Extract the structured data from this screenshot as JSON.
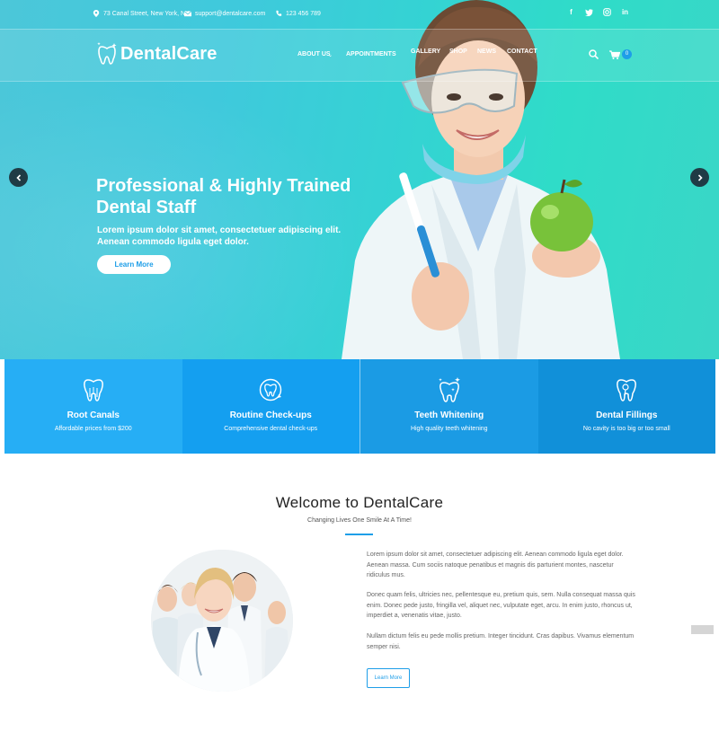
{
  "topbar": {
    "address": "73 Canal Street, New York, NY",
    "email": "support@dentalcare.com",
    "phone": "123 456 789",
    "social": [
      "facebook-icon",
      "twitter-icon",
      "instagram-icon",
      "linkedin-icon"
    ]
  },
  "brand": {
    "name": "DentalCare"
  },
  "nav": {
    "items": [
      {
        "label": "ABOUT US"
      },
      {
        "label": "APPOINTMENTS"
      },
      {
        "label": "GALLERY"
      },
      {
        "label": "SHOP"
      },
      {
        "label": "NEWS"
      },
      {
        "label": "CONTACT"
      }
    ],
    "cart_count": "0"
  },
  "hero": {
    "title_line1": "Professional & Highly Trained",
    "title_line2": "Dental Staff",
    "subtitle_line1": "Lorem ipsum dolor sit amet, consectetuer adipiscing elit.",
    "subtitle_line2": "Aenean commodo ligula eget dolor.",
    "button": "Learn More"
  },
  "services": [
    {
      "title": "Root Canals",
      "desc": "Affordable prices from $200",
      "color": "#26aef5",
      "icon": "tooth-roots-icon"
    },
    {
      "title": "Routine Check-ups",
      "desc": "Comprehensive dental check-ups",
      "color": "#149ff0",
      "icon": "tooth-checkup-icon"
    },
    {
      "title": "Teeth Whitening",
      "desc": "High quality teeth whitening",
      "color": "#1b9be4",
      "icon": "tooth-sparkle-icon"
    },
    {
      "title": "Dental Fillings",
      "desc": "No cavity is too big or too small",
      "color": "#1190d9",
      "icon": "tooth-filling-icon"
    }
  ],
  "welcome": {
    "title": "Welcome to DentalCare",
    "subtitle": "Changing Lives One Smile At A Time!",
    "p1": "Lorem ipsum dolor sit amet, consectetuer adipiscing elit. Aenean commodo ligula eget dolor. Aenean massa. Cum sociis natoque penatibus et magnis dis parturient montes, nascetur ridiculus mus.",
    "p2": "Donec quam felis, ultricies nec, pellentesque eu, pretium quis, sem. Nulla consequat massa quis enim. Donec pede justo, fringilla vel, aliquet nec, vulputate eget, arcu. In enim justo, rhoncus ut, imperdiet a, venenatis vitae, justo.",
    "p3": "Nullam dictum felis eu pede mollis pretium. Integer tincidunt. Cras dapibus. Vivamus elementum semper nisi.",
    "button": "Learn More"
  },
  "colors": {
    "accent": "#1e9ee8",
    "hero_start": "#4cc7d9",
    "hero_end": "#2fdcc8"
  }
}
